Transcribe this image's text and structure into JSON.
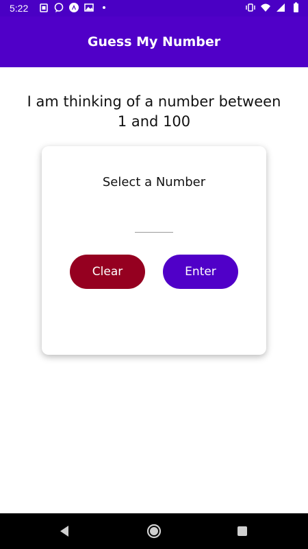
{
  "status_bar": {
    "time": "5:22",
    "icons_left": [
      "sim-icon",
      "chat-icon",
      "app-icon",
      "photo-icon",
      "dot-icon"
    ],
    "icons_right": [
      "vibrate-icon",
      "wifi-icon",
      "signal-icon",
      "battery-icon"
    ]
  },
  "app_bar": {
    "title": "Guess My Number",
    "color": "#5000c8"
  },
  "prompt": {
    "line1": "I am thinking of a number between",
    "line2": "1 and 100"
  },
  "card": {
    "title": "Select a Number",
    "input_value": "",
    "clear_label": "Clear",
    "enter_label": "Enter",
    "clear_color": "#950020",
    "enter_color": "#5000c8"
  },
  "nav_bar": {
    "buttons": [
      "back-icon",
      "home-icon",
      "recents-icon"
    ]
  }
}
